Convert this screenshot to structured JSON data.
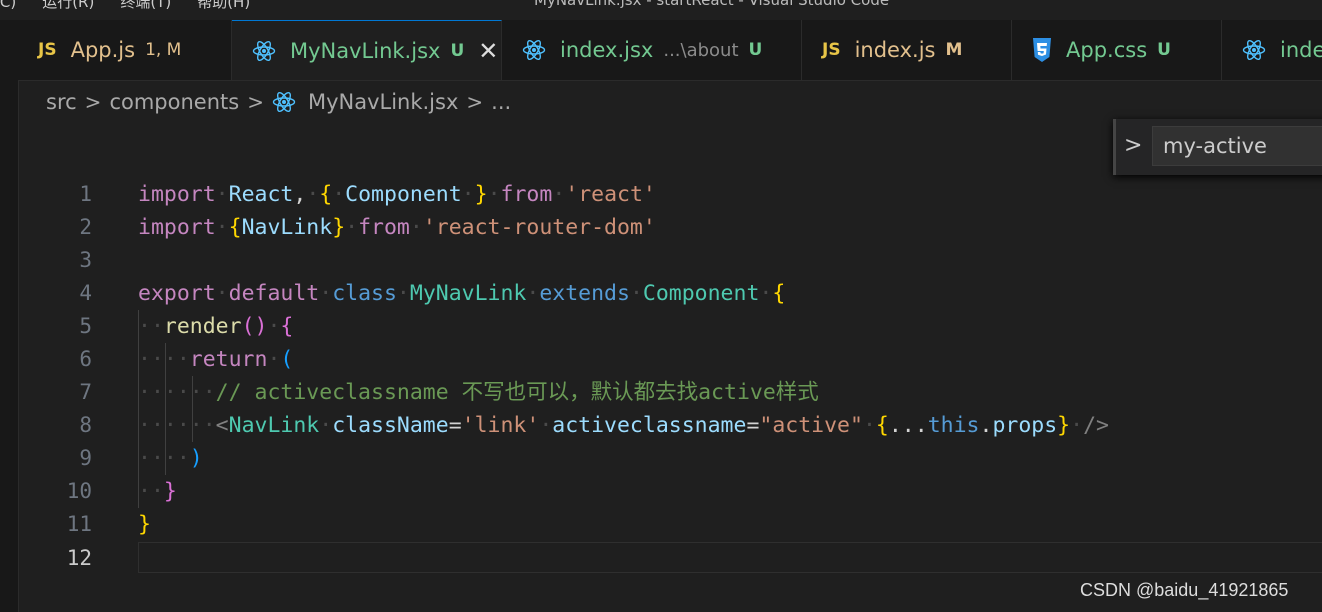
{
  "window": {
    "menu_items": [
      "(C)",
      "运行(R)",
      "终端(T)",
      "帮助(H)"
    ],
    "title": "MyNavLink.jsx - startReact - Visual Studio Code"
  },
  "tabs": [
    {
      "icon": "JS",
      "icon_name": "javascript-icon",
      "name": "App.js",
      "badge": "1, M",
      "active": false
    },
    {
      "icon": "react",
      "icon_name": "react-icon",
      "name": "MyNavLink.jsx",
      "badge": "U",
      "active": true,
      "close": "✕"
    },
    {
      "icon": "react",
      "icon_name": "react-icon",
      "name": "index.jsx",
      "description": "...\\about",
      "badge": "U",
      "active": false
    },
    {
      "icon": "JS",
      "icon_name": "javascript-icon",
      "name": "index.js",
      "badge": "M",
      "active": false
    },
    {
      "icon": "css",
      "icon_name": "css-icon",
      "name": "App.css",
      "badge": "U",
      "active": false
    },
    {
      "icon": "react",
      "icon_name": "react-icon",
      "name": "inde",
      "active": false
    }
  ],
  "breadcrumb": {
    "items": [
      "src",
      "components",
      "MyNavLink.jsx",
      "..."
    ],
    "separator": ">"
  },
  "find": {
    "toggle": ">",
    "value": "my-active"
  },
  "editor": {
    "current_line": 12,
    "lines": [
      {
        "n": "1"
      },
      {
        "n": "2"
      },
      {
        "n": "3"
      },
      {
        "n": "4"
      },
      {
        "n": "5"
      },
      {
        "n": "6"
      },
      {
        "n": "7"
      },
      {
        "n": "8"
      },
      {
        "n": "9"
      },
      {
        "n": "10"
      },
      {
        "n": "11"
      },
      {
        "n": "12"
      }
    ],
    "tokens": {
      "import": "import",
      "React": "React",
      "Component": "Component",
      "from": "from",
      "react": "'react'",
      "NavLink": "NavLink",
      "router": "'react-router-dom'",
      "export": "export",
      "default": "default",
      "class": "class",
      "MyNavLink": "MyNavLink",
      "extends": "extends",
      "render": "render",
      "return": "return",
      "comment": "// activeclassname 不写也可以，默认都去找active样式",
      "className": "className",
      "link": "'link'",
      "activeclassname": "activeclassname",
      "active": "\"active\"",
      "this": "this",
      "props": "props"
    },
    "colors": {
      "keyword": "#c586c0",
      "storage": "#569cd6",
      "variable": "#9cdcfe",
      "class": "#4ec9b0",
      "function": "#dcdcaa",
      "string": "#ce9178",
      "comment": "#6a9955"
    }
  },
  "watermark": "CSDN @baidu_41921865"
}
